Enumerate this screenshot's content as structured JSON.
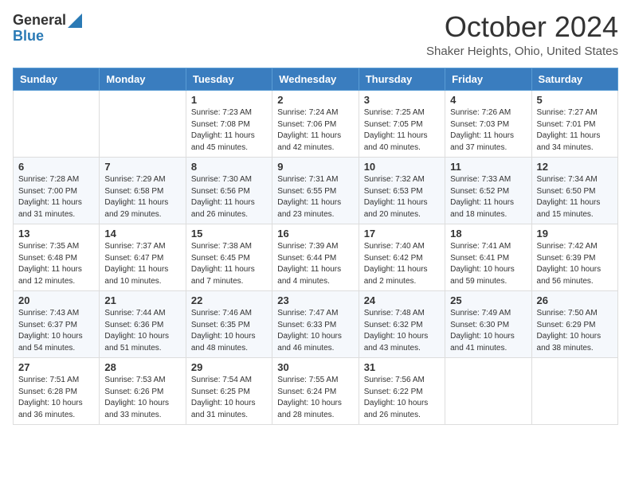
{
  "header": {
    "logo_general": "General",
    "logo_blue": "Blue",
    "month_title": "October 2024",
    "location": "Shaker Heights, Ohio, United States"
  },
  "days_of_week": [
    "Sunday",
    "Monday",
    "Tuesday",
    "Wednesday",
    "Thursday",
    "Friday",
    "Saturday"
  ],
  "weeks": [
    [
      {
        "day": "",
        "info": ""
      },
      {
        "day": "",
        "info": ""
      },
      {
        "day": "1",
        "info": "Sunrise: 7:23 AM\nSunset: 7:08 PM\nDaylight: 11 hours and 45 minutes."
      },
      {
        "day": "2",
        "info": "Sunrise: 7:24 AM\nSunset: 7:06 PM\nDaylight: 11 hours and 42 minutes."
      },
      {
        "day": "3",
        "info": "Sunrise: 7:25 AM\nSunset: 7:05 PM\nDaylight: 11 hours and 40 minutes."
      },
      {
        "day": "4",
        "info": "Sunrise: 7:26 AM\nSunset: 7:03 PM\nDaylight: 11 hours and 37 minutes."
      },
      {
        "day": "5",
        "info": "Sunrise: 7:27 AM\nSunset: 7:01 PM\nDaylight: 11 hours and 34 minutes."
      }
    ],
    [
      {
        "day": "6",
        "info": "Sunrise: 7:28 AM\nSunset: 7:00 PM\nDaylight: 11 hours and 31 minutes."
      },
      {
        "day": "7",
        "info": "Sunrise: 7:29 AM\nSunset: 6:58 PM\nDaylight: 11 hours and 29 minutes."
      },
      {
        "day": "8",
        "info": "Sunrise: 7:30 AM\nSunset: 6:56 PM\nDaylight: 11 hours and 26 minutes."
      },
      {
        "day": "9",
        "info": "Sunrise: 7:31 AM\nSunset: 6:55 PM\nDaylight: 11 hours and 23 minutes."
      },
      {
        "day": "10",
        "info": "Sunrise: 7:32 AM\nSunset: 6:53 PM\nDaylight: 11 hours and 20 minutes."
      },
      {
        "day": "11",
        "info": "Sunrise: 7:33 AM\nSunset: 6:52 PM\nDaylight: 11 hours and 18 minutes."
      },
      {
        "day": "12",
        "info": "Sunrise: 7:34 AM\nSunset: 6:50 PM\nDaylight: 11 hours and 15 minutes."
      }
    ],
    [
      {
        "day": "13",
        "info": "Sunrise: 7:35 AM\nSunset: 6:48 PM\nDaylight: 11 hours and 12 minutes."
      },
      {
        "day": "14",
        "info": "Sunrise: 7:37 AM\nSunset: 6:47 PM\nDaylight: 11 hours and 10 minutes."
      },
      {
        "day": "15",
        "info": "Sunrise: 7:38 AM\nSunset: 6:45 PM\nDaylight: 11 hours and 7 minutes."
      },
      {
        "day": "16",
        "info": "Sunrise: 7:39 AM\nSunset: 6:44 PM\nDaylight: 11 hours and 4 minutes."
      },
      {
        "day": "17",
        "info": "Sunrise: 7:40 AM\nSunset: 6:42 PM\nDaylight: 11 hours and 2 minutes."
      },
      {
        "day": "18",
        "info": "Sunrise: 7:41 AM\nSunset: 6:41 PM\nDaylight: 10 hours and 59 minutes."
      },
      {
        "day": "19",
        "info": "Sunrise: 7:42 AM\nSunset: 6:39 PM\nDaylight: 10 hours and 56 minutes."
      }
    ],
    [
      {
        "day": "20",
        "info": "Sunrise: 7:43 AM\nSunset: 6:37 PM\nDaylight: 10 hours and 54 minutes."
      },
      {
        "day": "21",
        "info": "Sunrise: 7:44 AM\nSunset: 6:36 PM\nDaylight: 10 hours and 51 minutes."
      },
      {
        "day": "22",
        "info": "Sunrise: 7:46 AM\nSunset: 6:35 PM\nDaylight: 10 hours and 48 minutes."
      },
      {
        "day": "23",
        "info": "Sunrise: 7:47 AM\nSunset: 6:33 PM\nDaylight: 10 hours and 46 minutes."
      },
      {
        "day": "24",
        "info": "Sunrise: 7:48 AM\nSunset: 6:32 PM\nDaylight: 10 hours and 43 minutes."
      },
      {
        "day": "25",
        "info": "Sunrise: 7:49 AM\nSunset: 6:30 PM\nDaylight: 10 hours and 41 minutes."
      },
      {
        "day": "26",
        "info": "Sunrise: 7:50 AM\nSunset: 6:29 PM\nDaylight: 10 hours and 38 minutes."
      }
    ],
    [
      {
        "day": "27",
        "info": "Sunrise: 7:51 AM\nSunset: 6:28 PM\nDaylight: 10 hours and 36 minutes."
      },
      {
        "day": "28",
        "info": "Sunrise: 7:53 AM\nSunset: 6:26 PM\nDaylight: 10 hours and 33 minutes."
      },
      {
        "day": "29",
        "info": "Sunrise: 7:54 AM\nSunset: 6:25 PM\nDaylight: 10 hours and 31 minutes."
      },
      {
        "day": "30",
        "info": "Sunrise: 7:55 AM\nSunset: 6:24 PM\nDaylight: 10 hours and 28 minutes."
      },
      {
        "day": "31",
        "info": "Sunrise: 7:56 AM\nSunset: 6:22 PM\nDaylight: 10 hours and 26 minutes."
      },
      {
        "day": "",
        "info": ""
      },
      {
        "day": "",
        "info": ""
      }
    ]
  ]
}
